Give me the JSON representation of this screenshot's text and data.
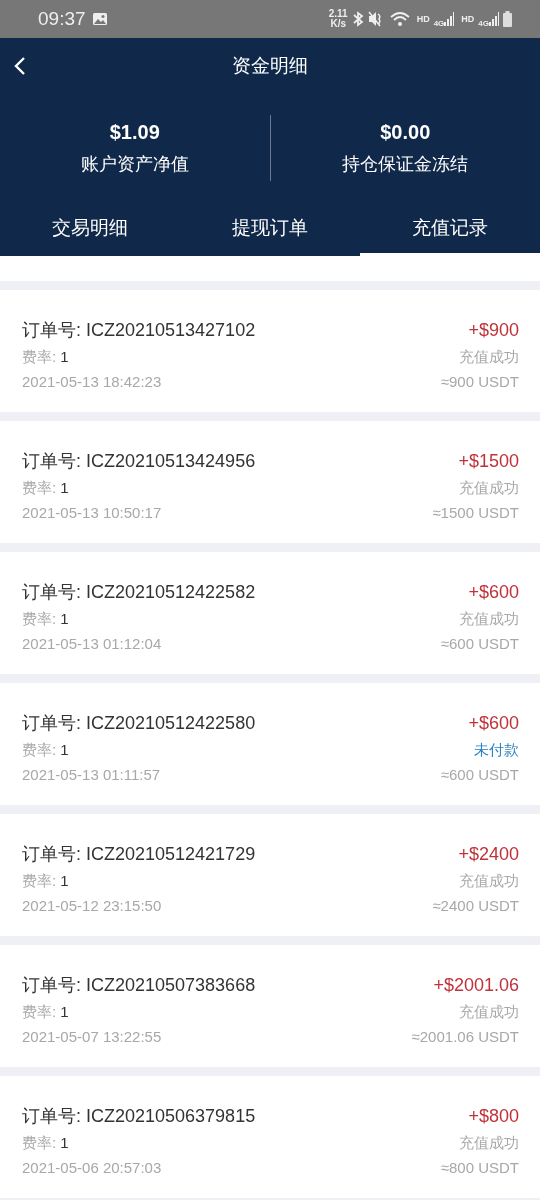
{
  "status_bar": {
    "time": "09:37",
    "speed_value": "2.11",
    "speed_unit": "K/s",
    "sims": [
      {
        "hd": "HD",
        "network": "4G"
      },
      {
        "hd": "HD",
        "network": "4G"
      }
    ]
  },
  "header": {
    "title": "资金明细"
  },
  "summary": [
    {
      "value": "$1.09",
      "label": "账户资产净值"
    },
    {
      "value": "$0.00",
      "label": "持仓保证金冻结"
    }
  ],
  "tabs": [
    {
      "label": "交易明细",
      "selected": false
    },
    {
      "label": "提现订单",
      "selected": false
    },
    {
      "label": "充值记录",
      "selected": true
    }
  ],
  "records": [
    {
      "order": "订单号: ICZ20210513427102",
      "fee_label": "费率:",
      "fee": "1",
      "time": "2021-05-13 18:42:23",
      "amount": "+$900",
      "status": "充值成功",
      "color": "#a8a8a8",
      "usdt": "≈900 USDT"
    },
    {
      "order": "订单号: ICZ20210513424956",
      "fee_label": "费率:",
      "fee": "1",
      "time": "2021-05-13 10:50:17",
      "amount": "+$1500",
      "status": "充值成功",
      "color": "#a8a8a8",
      "usdt": "≈1500 USDT"
    },
    {
      "order": "订单号: ICZ20210512422582",
      "fee_label": "费率:",
      "fee": "1",
      "time": "2021-05-13 01:12:04",
      "amount": "+$600",
      "status": "充值成功",
      "color": "#a8a8a8",
      "usdt": "≈600 USDT"
    },
    {
      "order": "订单号: ICZ20210512422580",
      "fee_label": "费率:",
      "fee": "1",
      "time": "2021-05-13 01:11:57",
      "amount": "+$600",
      "status": "未付款",
      "color": "#2b80c0",
      "usdt": "≈600 USDT"
    },
    {
      "order": "订单号: ICZ20210512421729",
      "fee_label": "费率:",
      "fee": "1",
      "time": "2021-05-12 23:15:50",
      "amount": "+$2400",
      "status": "充值成功",
      "color": "#a8a8a8",
      "usdt": "≈2400 USDT"
    },
    {
      "order": "订单号: ICZ20210507383668",
      "fee_label": "费率:",
      "fee": "1",
      "time": "2021-05-07 13:22:55",
      "amount": "+$2001.06",
      "status": "充值成功",
      "color": "#a8a8a8",
      "usdt": "≈2001.06 USDT"
    },
    {
      "order": "订单号: ICZ20210506379815",
      "fee_label": "费率:",
      "fee": "1",
      "time": "2021-05-06 20:57:03",
      "amount": "+$800",
      "status": "充值成功",
      "color": "#a8a8a8",
      "usdt": "≈800 USDT"
    }
  ]
}
